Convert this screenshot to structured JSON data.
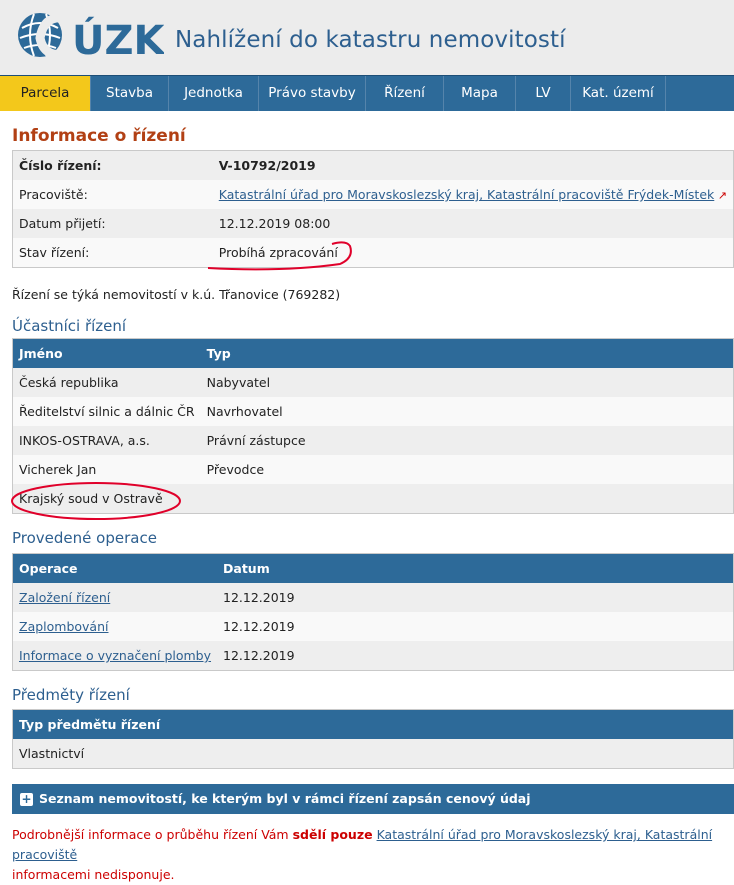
{
  "header": {
    "logo_text": "ÚZK",
    "title": "Nahlížení do katastru nemovitostí"
  },
  "nav": [
    "Parcela",
    "Stavba",
    "Jednotka",
    "Právo stavby",
    "Řízení",
    "Mapa",
    "LV",
    "Kat. území"
  ],
  "info": {
    "heading": "Informace o řízení",
    "rows": [
      {
        "label": "Číslo řízení:",
        "value": "V-10792/2019"
      },
      {
        "label": "Pracoviště:",
        "value": "Katastrální úřad pro Moravskoslezský kraj, Katastrální pracoviště Frýdek-Místek"
      },
      {
        "label": "Datum přijetí:",
        "value": "12.12.2019 08:00"
      },
      {
        "label": "Stav řízení:",
        "value": "Probíhá zpracování"
      }
    ]
  },
  "property_note": "Řízení se týká nemovitostí v k.ú. Třanovice (769282)",
  "participants": {
    "heading": "Účastníci řízení",
    "col_name": "Jméno",
    "col_type": "Typ",
    "rows": [
      {
        "name": "Česká republika",
        "type": "Nabyvatel"
      },
      {
        "name": "Ředitelství silnic a dálnic ČR",
        "type": "Navrhovatel"
      },
      {
        "name": "INKOS-OSTRAVA, a.s.",
        "type": "Právní zástupce"
      },
      {
        "name": "Vicherek Jan",
        "type": "Převodce"
      },
      {
        "name": "Krajský soud v Ostravě",
        "type": ""
      }
    ]
  },
  "operations": {
    "heading": "Provedené operace",
    "col_op": "Operace",
    "col_date": "Datum",
    "rows": [
      {
        "op": "Založení řízení",
        "date": "12.12.2019"
      },
      {
        "op": "Zaplombování",
        "date": "12.12.2019"
      },
      {
        "op": "Informace o vyznačení plomby",
        "date": "12.12.2019"
      }
    ]
  },
  "subjects": {
    "heading": "Předměty řízení",
    "col": "Typ předmětu řízení",
    "rows": [
      "Vlastnictví"
    ]
  },
  "price_bar": "Seznam nemovitostí, ke kterým byl v rámci řízení zapsán cenový údaj",
  "footer": {
    "part1": "Podrobnější informace o průběhu řízení Vám ",
    "bold": "sdělí pouze",
    "link": "Katastrální úřad pro Moravskoslezský kraj, Katastrální pracoviště",
    "line2": "informacemi nedisponuje."
  },
  "colors": {
    "nav_bg": "#2d6a99",
    "active_tab": "#f3c81b",
    "heading_red": "#b24014",
    "annotation": "#e0002a"
  }
}
